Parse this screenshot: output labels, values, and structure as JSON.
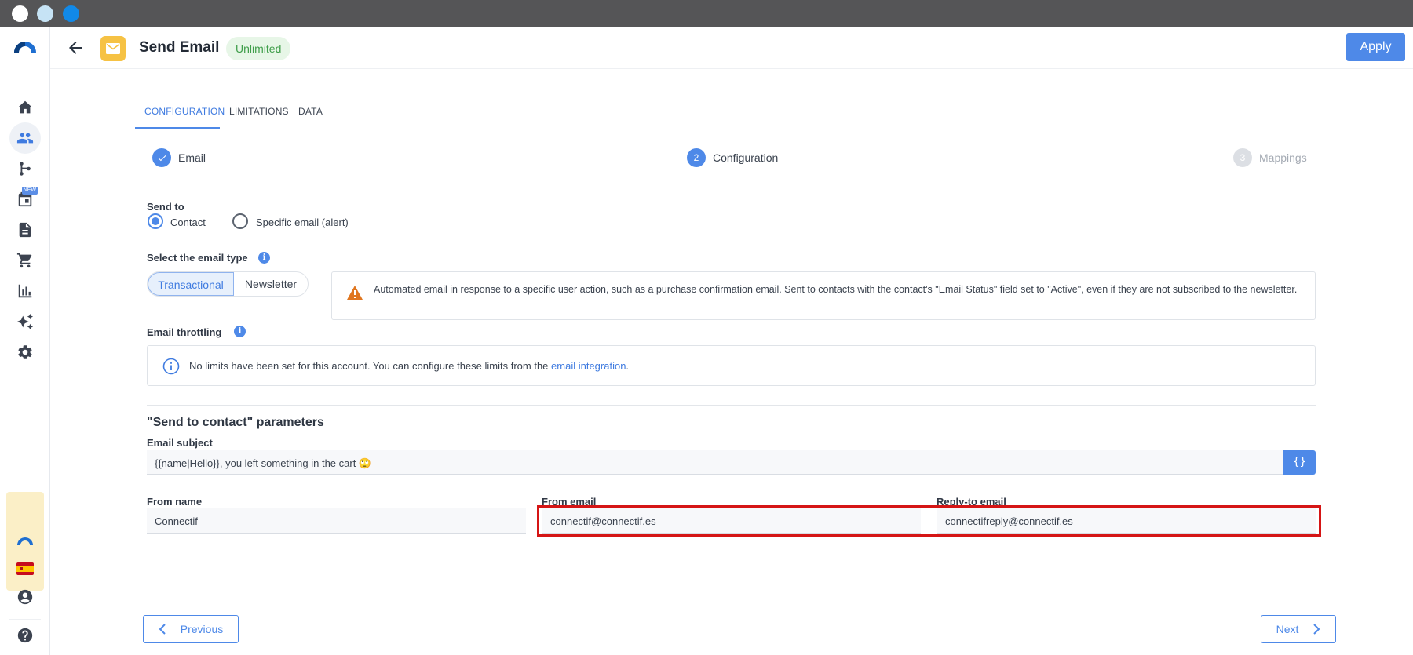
{
  "window": {
    "controls": [
      "close",
      "minimize",
      "maximize"
    ]
  },
  "sidebar": {
    "items": [
      {
        "icon": "home-icon"
      },
      {
        "icon": "contacts-icon",
        "active": true
      },
      {
        "icon": "workflow-icon"
      },
      {
        "icon": "calendar-icon",
        "badge": "NEW"
      },
      {
        "icon": "document-icon"
      },
      {
        "icon": "cart-icon"
      },
      {
        "icon": "analytics-icon"
      },
      {
        "icon": "sparkles-icon"
      },
      {
        "icon": "settings-icon"
      }
    ],
    "bottom": [
      {
        "icon": "account-icon"
      },
      {
        "icon": "help-icon"
      }
    ]
  },
  "header": {
    "title": "Send Email",
    "badge": "Unlimited",
    "apply_label": "Apply"
  },
  "tabs": [
    {
      "label": "CONFIGURATION",
      "active": true
    },
    {
      "label": "LIMITATIONS"
    },
    {
      "label": "DATA"
    }
  ],
  "stepper": {
    "steps": [
      {
        "number": "1",
        "label": "Email",
        "state": "done"
      },
      {
        "number": "2",
        "label": "Configuration",
        "state": "current"
      },
      {
        "number": "3",
        "label": "Mappings",
        "state": "pending"
      }
    ]
  },
  "send_to": {
    "label": "Send to",
    "options": [
      {
        "label": "Contact",
        "checked": true
      },
      {
        "label": "Specific email (alert)",
        "checked": false
      }
    ]
  },
  "email_type": {
    "label": "Select the email type",
    "options": [
      {
        "label": "Transactional",
        "active": true
      },
      {
        "label": "Newsletter",
        "active": false
      }
    ],
    "alert_text": "Automated email in response to a specific user action, such as a purchase confirmation email. Sent to contacts with the contact's \"Email Status\" field set to \"Active\", even if they are not subscribed to the newsletter."
  },
  "throttling": {
    "label": "Email throttling",
    "text_before": "No limits have been set for this account. You can configure these limits from the ",
    "link": "email integration",
    "text_after": "."
  },
  "params": {
    "title": "\"Send to contact\" parameters",
    "subject_label": "Email subject",
    "subject_value": "{{name|Hello}}, you left something in the cart 🙄",
    "variables_button": "{}",
    "from_name_label": "From name",
    "from_name_value": "Connectif",
    "from_email_label": "From email",
    "from_email_value": "connectif@connectif.es",
    "reply_to_label": "Reply-to email",
    "reply_to_value": "connectifreply@connectif.es"
  },
  "footer": {
    "previous_label": "Previous",
    "next_label": "Next"
  },
  "colors": {
    "accent": "#4e89e8",
    "highlight": "#d51515",
    "badge_bg": "#e7f6e7",
    "badge_text": "#3f9e4a",
    "warning": "#e0761f"
  }
}
